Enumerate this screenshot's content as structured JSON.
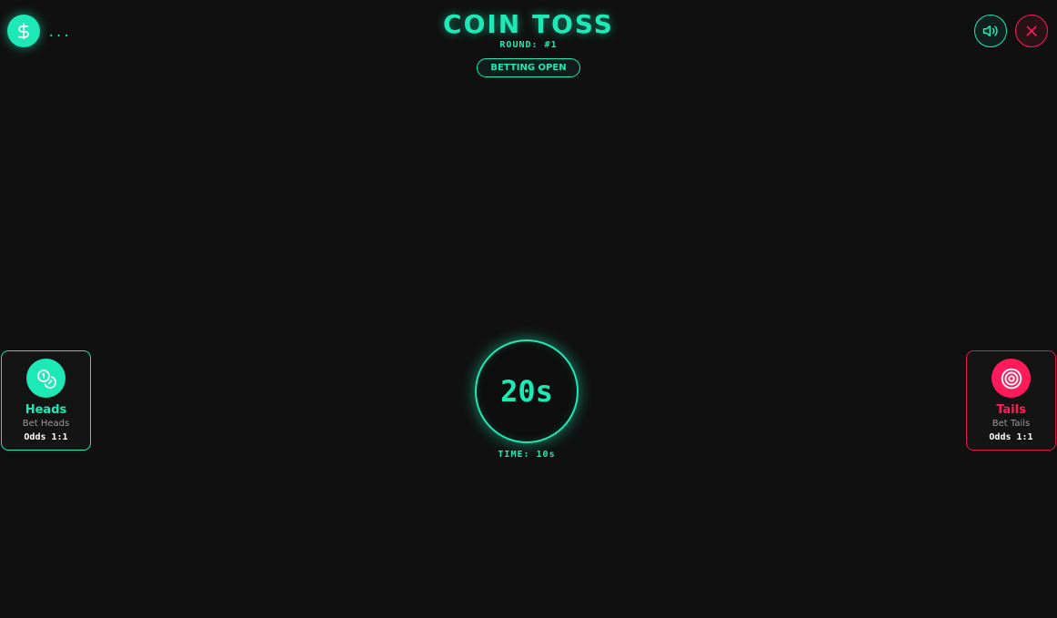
{
  "balance": {
    "icon": "dollar-icon",
    "value": "..."
  },
  "header": {
    "title": "COIN TOSS",
    "round": "ROUND: #1",
    "status": "BETTING OPEN"
  },
  "controls": {
    "sound_icon": "speaker-icon",
    "close_icon": "close-icon"
  },
  "timer": {
    "value": "20s",
    "label": "TIME: 10s"
  },
  "bets": {
    "heads": {
      "name": "Heads",
      "subtitle": "Bet Heads",
      "odds": "Odds 1:1",
      "icon": "coins-icon",
      "color": "#1de9b6"
    },
    "tails": {
      "name": "Tails",
      "subtitle": "Bet Tails",
      "odds": "Odds 1:1",
      "icon": "target-icon",
      "color": "#ff1a5a"
    }
  },
  "colors": {
    "accent": "#1de9b6",
    "danger": "#ff1a5a",
    "background": "#101010"
  }
}
